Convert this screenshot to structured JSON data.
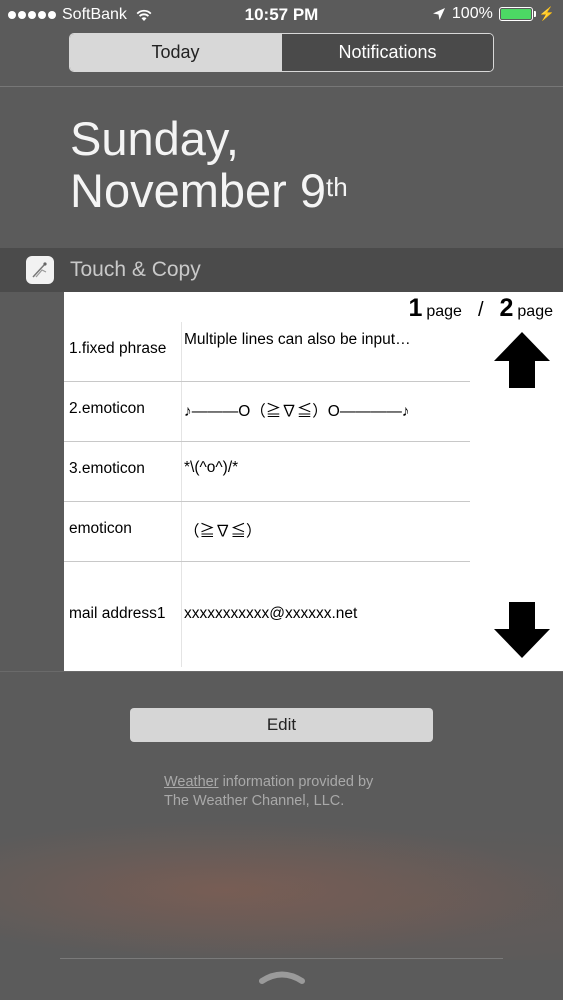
{
  "status_bar": {
    "carrier": "SoftBank",
    "time": "10:57 PM",
    "battery": "100%",
    "icons": [
      "signal-dots-icon",
      "wifi-icon",
      "location-arrow-icon",
      "battery-icon",
      "charging-bolt-icon"
    ],
    "battery_color": "#4cd964"
  },
  "tabs": [
    {
      "label": "Today",
      "selected": true
    },
    {
      "label": "Notifications",
      "selected": false
    }
  ],
  "date": {
    "line1": "Sunday,",
    "line2_main": "November 9",
    "line2_suffix": "th"
  },
  "widget": {
    "title": "Touch & Copy",
    "pager": {
      "current": "1",
      "current_label": "page",
      "separator": "/",
      "total": "2",
      "total_label": "page"
    },
    "rows": [
      {
        "name": "1.fixed phrase",
        "value": "Multiple lines can also be input…"
      },
      {
        "name": "2.emoticon",
        "value": "♪———O（≧∇≦）O————♪"
      },
      {
        "name": "3.emoticon",
        "value": "*\\(^o^)/*"
      },
      {
        "name": "emoticon",
        "value": "（≧∇≦）"
      },
      {
        "name": "mail address1",
        "value": "xxxxxxxxxxx@xxxxxx.net"
      }
    ]
  },
  "edit_label": "Edit",
  "attribution": {
    "link": "Weather",
    "rest_line1": " information provided by",
    "line2": "The Weather Channel, LLC."
  }
}
